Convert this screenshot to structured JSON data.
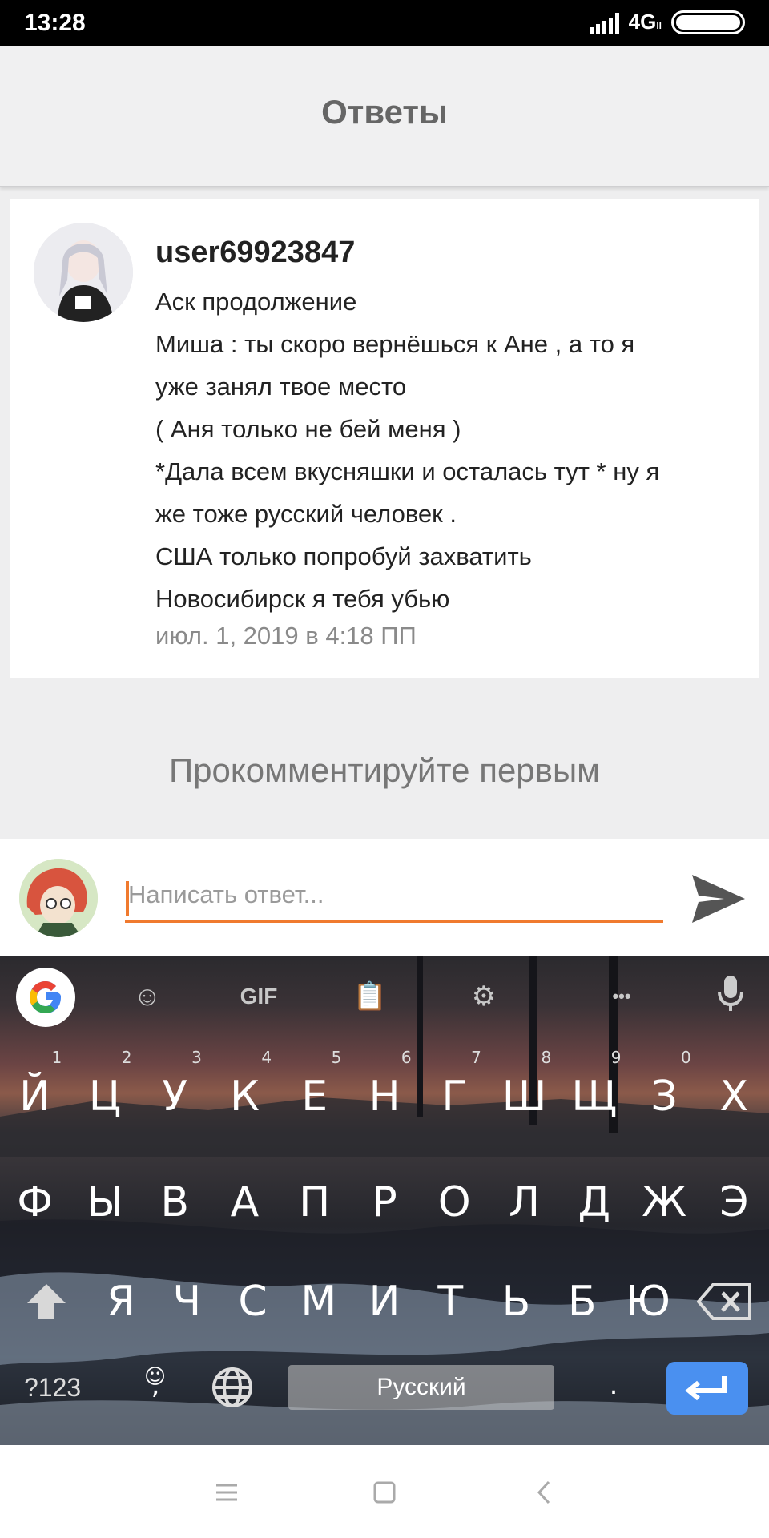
{
  "status_bar": {
    "time": "13:28",
    "network": "4G",
    "network_sub": "ll"
  },
  "header": {
    "title": "Ответы"
  },
  "post": {
    "username": "user69923847",
    "lines": [
      "Аск продолжение",
      "Миша : ты скоро вернёшься к Ане , а то я",
      "уже занял твое место",
      "( Аня только не бей меня )",
      "*Дала всем вкусняшки и осталась тут * ну я",
      "же тоже русский человек .",
      "США только попробуй захватить",
      "Новосибирск я тебя убью"
    ],
    "date": "июл. 1, 2019 в 4:18 ПП"
  },
  "empty_state": "Прокомментируйте первым",
  "reply": {
    "placeholder": "Написать ответ..."
  },
  "keyboard": {
    "toolbar": {
      "gif": "GIF",
      "more": "•••"
    },
    "row1": [
      {
        "k": "Й",
        "n": "1"
      },
      {
        "k": "Ц",
        "n": "2"
      },
      {
        "k": "У",
        "n": "3"
      },
      {
        "k": "К",
        "n": "4"
      },
      {
        "k": "Е",
        "n": "5"
      },
      {
        "k": "Н",
        "n": "6"
      },
      {
        "k": "Г",
        "n": "7"
      },
      {
        "k": "Ш",
        "n": "8"
      },
      {
        "k": "Щ",
        "n": "9"
      },
      {
        "k": "З",
        "n": "0"
      },
      {
        "k": "Х",
        "n": ""
      }
    ],
    "row2": [
      "Ф",
      "Ы",
      "В",
      "А",
      "П",
      "Р",
      "О",
      "Л",
      "Д",
      "Ж",
      "Э"
    ],
    "row3": [
      "Я",
      "Ч",
      "С",
      "М",
      "И",
      "Т",
      "Ь",
      "Б",
      "Ю"
    ],
    "symbols_key": "?123",
    "comma_key": ",",
    "period_key": ".",
    "space_label": "Русский"
  },
  "colors": {
    "accent": "#f07a2e",
    "enter": "#4a90f0"
  }
}
